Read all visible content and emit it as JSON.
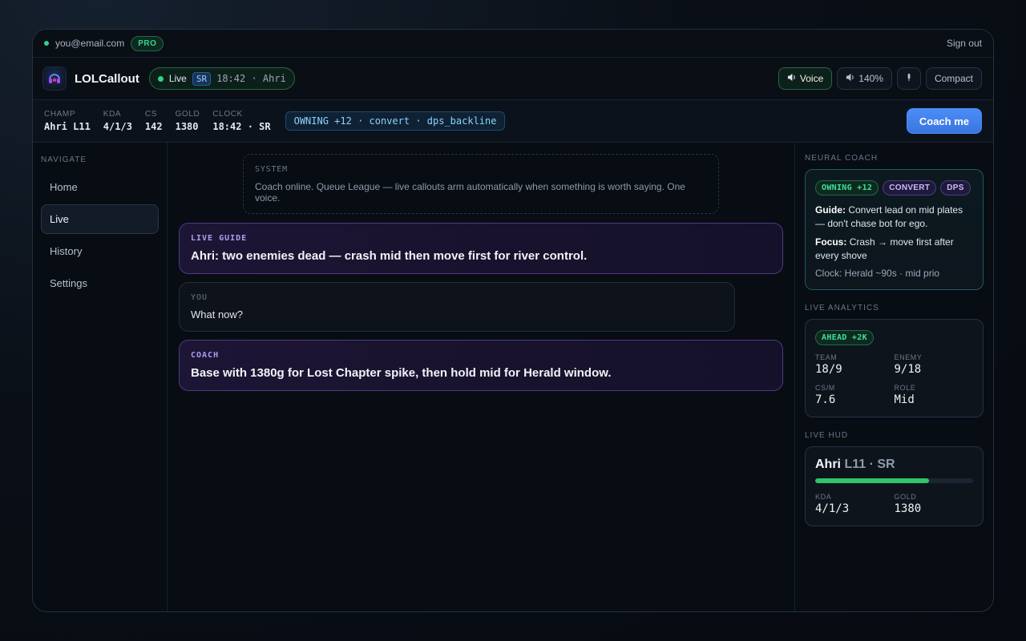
{
  "account": {
    "email": "you@email.com",
    "plan": "PRO",
    "signout_label": "Sign out"
  },
  "header": {
    "brand": "LOLCallout",
    "live_label": "Live",
    "map_tag": "SR",
    "live_clock": "18:42 · Ahri",
    "voice_label": "Voice",
    "volume_label": "140%",
    "compact_label": "Compact"
  },
  "stats": [
    {
      "label": "CHAMP",
      "value": "Ahri L11"
    },
    {
      "label": "KDA",
      "value": "4/1/3"
    },
    {
      "label": "CS",
      "value": "142"
    },
    {
      "label": "GOLD",
      "value": "1380"
    },
    {
      "label": "CLOCK",
      "value": "18:42 · SR"
    }
  ],
  "state_chip": "OWNING +12 · convert · dps_backline",
  "coach_button": "Coach me",
  "nav": {
    "title": "NAVIGATE",
    "items": [
      "Home",
      "Live",
      "History",
      "Settings"
    ],
    "active": "Live"
  },
  "feed": {
    "system": {
      "label": "SYSTEM",
      "text": "Coach online. Queue League — live callouts arm automatically when something is worth saying. One voice."
    },
    "guide": {
      "label": "LIVE GUIDE",
      "text": "Ahri: two enemies dead — crash mid then move first for river control."
    },
    "you": {
      "label": "YOU",
      "text": "What now?"
    },
    "coach": {
      "label": "COACH",
      "text": "Base with 1380g for Lost Chapter spike, then hold mid for Herald window."
    }
  },
  "neural_coach": {
    "title": "NEURAL COACH",
    "chips": [
      "OWNING +12",
      "CONVERT",
      "DPS"
    ],
    "guide_label": "Guide:",
    "guide_text": "Convert lead on mid plates — don't chase bot for ego.",
    "focus_label": "Focus:",
    "focus_text": "Crash → move first after every shove",
    "clock": "Clock: Herald ~90s · mid prio"
  },
  "analytics": {
    "title": "LIVE ANALYTICS",
    "chip": "AHEAD +2K",
    "team_label": "TEAM",
    "team_value": "18/9",
    "enemy_label": "ENEMY",
    "enemy_value": "9/18",
    "csm_label": "CS/M",
    "csm_value": "7.6",
    "role_label": "ROLE",
    "role_value": "Mid"
  },
  "hud": {
    "title": "LIVE HUD",
    "champ": "Ahri",
    "sub": "L11 · SR",
    "health_fraction": 0.72,
    "kda_label": "KDA",
    "kda_value": "4/1/3",
    "gold_label": "GOLD",
    "gold_value": "1380"
  },
  "colors": {
    "accent_green": "#2fd38a",
    "accent_blue": "#4b8df6",
    "accent_purple": "#b19cf0"
  }
}
